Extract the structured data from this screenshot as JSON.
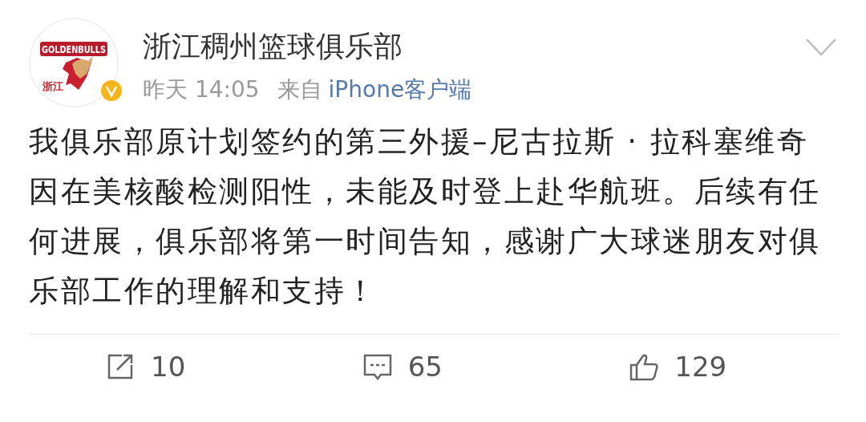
{
  "post": {
    "author": "浙江稠州篮球俱乐部",
    "avatar_logo": {
      "wordmark": "GOLDENBULLS",
      "region": "浙江"
    },
    "verified": true,
    "time": "昨天 14:05",
    "source_prefix": "来自",
    "source": "iPhone客户端",
    "text": "我俱乐部原计划签约的第三外援–尼古拉斯 · 拉科塞维奇因在美核酸检测阳性，未能及时登上赴华航班。后续有任何进展，俱乐部将第一时间告知，感谢广大球迷朋友对俱乐部工作的理解和支持！"
  },
  "actions": [
    {
      "kind": "repost",
      "count": "10"
    },
    {
      "kind": "comment",
      "count": "65"
    },
    {
      "kind": "like",
      "count": "129"
    }
  ]
}
